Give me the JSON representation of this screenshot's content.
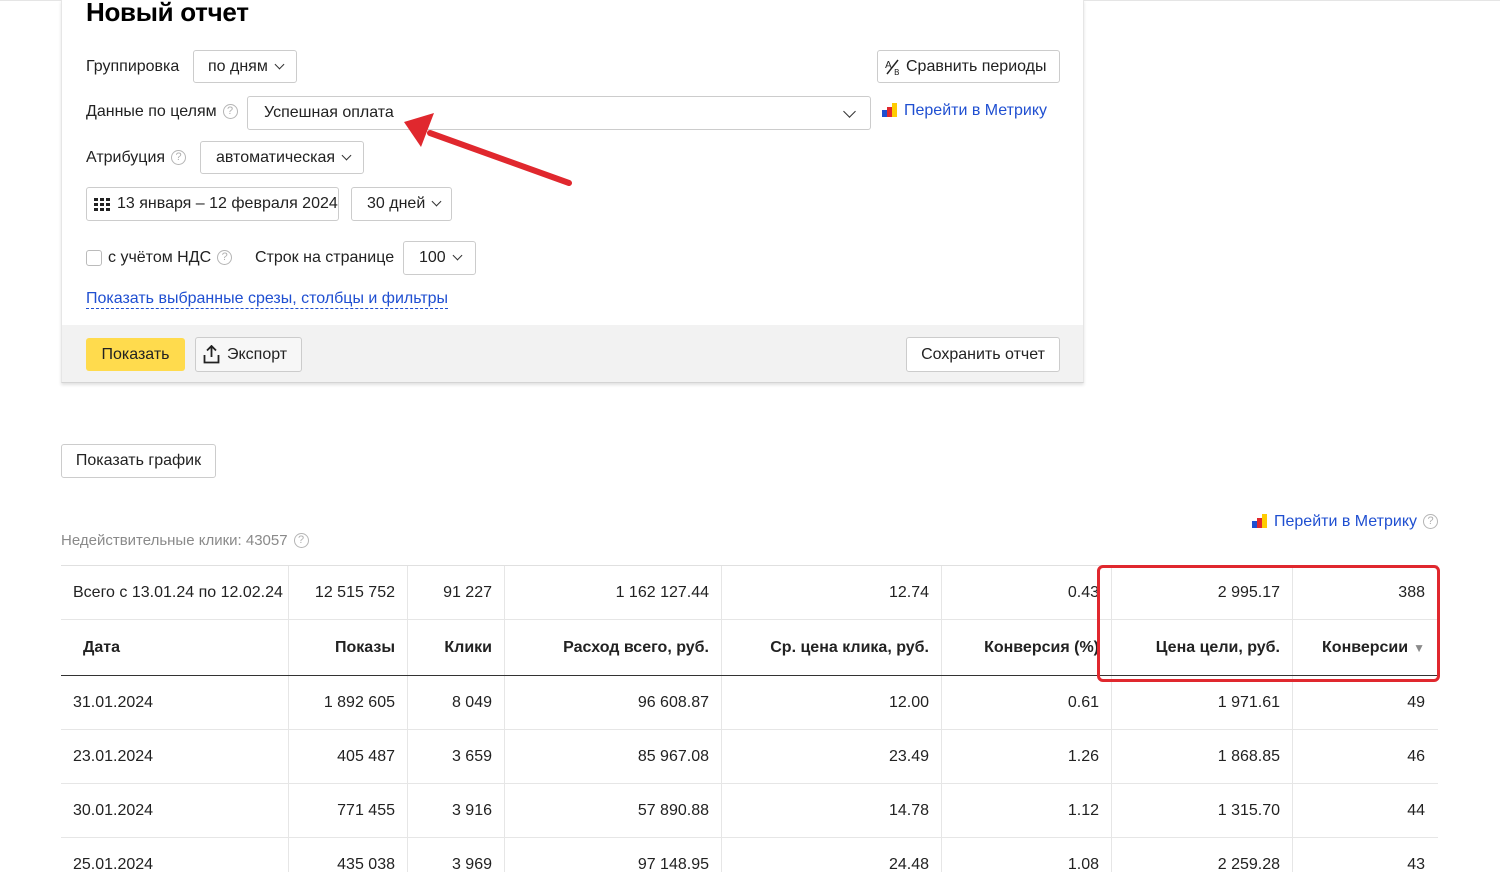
{
  "title": "Новый отчет",
  "grouping": {
    "label": "Группировка",
    "value": "по дням"
  },
  "compare_periods": {
    "label": "Сравнить периоды"
  },
  "goals": {
    "label": "Данные по целям",
    "value": "Успешная оплата"
  },
  "metrika_link": "Перейти в Метрику",
  "attribution": {
    "label": "Атрибуция",
    "value": "автоматическая"
  },
  "date_range": {
    "value": "13 января – 12 февраля 2024",
    "period": "30 дней"
  },
  "vat": {
    "label": "с учётом НДС",
    "checked": false
  },
  "rows_per_page": {
    "label": "Строк на странице",
    "value": "100"
  },
  "show_slices_link": "Показать выбранные срезы, столбцы и фильтры",
  "buttons": {
    "show": "Показать",
    "export": "Экспорт",
    "save": "Сохранить отчет",
    "show_graph": "Показать график"
  },
  "invalid_clicks": "Недействительные клики: 43057",
  "help_glyph": "?",
  "sort_glyph": "▼",
  "table": {
    "total": [
      "Всего с 13.01.24 по 12.02.24",
      "12 515 752",
      "91 227",
      "1 162 127.44",
      "12.74",
      "0.43",
      "2 995.17",
      "388"
    ],
    "headers": [
      "Дата",
      "Показы",
      "Клики",
      "Расход всего, руб.",
      "Ср. цена клика, руб.",
      "Конверсия (%)",
      "Цена цели, руб.",
      "Конверсии"
    ],
    "rows": [
      [
        "31.01.2024",
        "1 892 605",
        "8 049",
        "96 608.87",
        "12.00",
        "0.61",
        "1 971.61",
        "49"
      ],
      [
        "23.01.2024",
        "405 487",
        "3 659",
        "85 967.08",
        "23.49",
        "1.26",
        "1 868.85",
        "46"
      ],
      [
        "30.01.2024",
        "771 455",
        "3 916",
        "57 890.88",
        "14.78",
        "1.12",
        "1 315.70",
        "44"
      ],
      [
        "25.01.2024",
        "435 038",
        "3 969",
        "97 148.95",
        "24.48",
        "1.08",
        "2 259.28",
        "43"
      ]
    ]
  },
  "colors": {
    "accent_yellow": "#ffdb4d",
    "link_blue": "#1f4fd1",
    "highlight_red": "#e0282e"
  }
}
